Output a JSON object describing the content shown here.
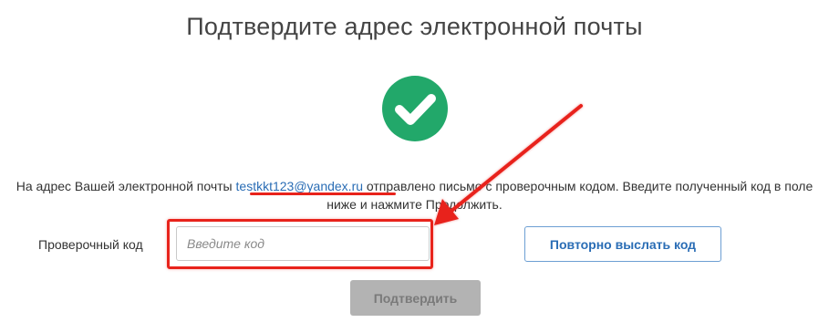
{
  "title": "Подтвердите адрес электронной почты",
  "status_icon": "check-circle-icon",
  "message": {
    "before_email": "На адрес Вашей электронной почты ",
    "email": "testkkt123@yandex.ru",
    "after_email": " отправлено письмо с проверочным кодом. Введите полученный код в поле ниже и нажмите Продолжить."
  },
  "form": {
    "code_label": "Проверочный код",
    "code_value": "",
    "code_placeholder": "Введите код",
    "resend_label": "Повторно выслать код",
    "confirm_label": "Подтвердить",
    "confirm_enabled": false
  },
  "colors": {
    "accent": "#22a86a",
    "link": "#2a6db5",
    "annotation": "#e8231b",
    "disabled_button": "#b3b3b3"
  }
}
